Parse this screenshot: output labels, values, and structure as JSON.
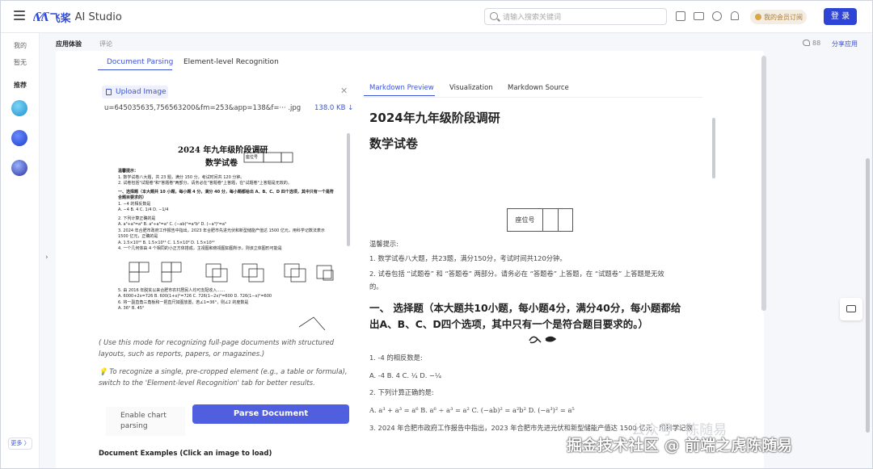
{
  "topbar": {
    "logo_mark": "ʎ⁄ʎ",
    "logo_cn": "飞桨",
    "logo_en": "AI Studio",
    "search_placeholder": "请输入搜索关键词",
    "vip_label": "我的会员订阅",
    "login_label": "登 录"
  },
  "sidebar": {
    "mine": "我的",
    "none": "暂无",
    "recommend": "推荐",
    "more": "更多 〉"
  },
  "subheader": {
    "tab_experience": "应用体验",
    "tab_comments": "评论",
    "likes": "88",
    "share": "分享应用"
  },
  "left_panel": {
    "tab_parsing": "Document Parsing",
    "tab_element": "Element-level Recognition",
    "upload_label": "Upload Image",
    "file_name": "u=645035635,756563200&fm=253&app=138&f=··· .jpg",
    "file_size": "138.0 KB ↓",
    "note_1": "( Use this mode for recognizing full-page documents with structured layouts, such as reports, papers, or magazines.)",
    "note_2": "💡 To recognize a single, pre-cropped element (e.g., a table or formula), switch to the 'Element-level Recognition' tab for better results.",
    "enable_chart": "Enable chart parsing",
    "parse_button": "Parse Document",
    "examples_heading": "Document Examples (Click an image to load)"
  },
  "thumbnail": {
    "title": "2024 年九年级阶段调研",
    "subtitle": "数学试卷",
    "seat": "座位号",
    "tips_head": "温馨提示：",
    "tip1": "1. 数学试卷八大题，共 23 题，满分 150 分，考试时间共 120 分钟。",
    "tip2": "2. 试卷包括\"试题卷\"和\"答题卷\"两部分，请务必在\"答题卷\"上答题，在\"试题卷\"上答题是无效的。",
    "sec1": "一、选择题（本大题共 10 小题，每小题 4 分，满分 40 分，每小题都给出 A、B、C、D 四个选项，其中只有一个是符合题目要求的）",
    "q1": "1. −4 的相反数是",
    "q1_opts": "A. −4      B. 4      C. 1/4      D. −1/4",
    "q2": "2. 下列计算正确的是",
    "q2_opts": "A. a³+a³=a⁶   B. a⁶÷a³=a²   C. (−ab)²=a²b²   D. (−a³)²=a⁵",
    "q3": "3. 2024 年合肥市政府工作报告中指出，2023 年合肥市先进光伏和新型储能产值达 1500 亿元，用科学记数法表示 1500 亿元，正确的是",
    "q3_opts": "A. 1.5×10¹⁰   B. 1.5×10¹¹   C. 1.5×10⁹   D. 1.5×10¹²",
    "q4": "4. 一个几何体由 4 个相同的小正方体搭成，主视图和俯视图如图所示，则该立体图形可能是",
    "q5": "5. 由 2016 年脱贫以来合肥市农村居民人均可支配收入……",
    "q5_opts": "A. 6000+2x=726   B. 600(1+x)²=726   C. 726(1−2x)²=600   D. 726(1−x)²=600",
    "q6": "6. 将一副直角三角板和一把直尺如图放置，若∠1=36°，则∠2 的度数是",
    "q6_opts": "A. 36°      B. 45°"
  },
  "right_panel": {
    "tab_preview": "Markdown Preview",
    "tab_visual": "Visualization",
    "tab_source": "Markdown Source"
  },
  "preview": {
    "h1": "2024年九年级阶段调研",
    "h1b": "数学试卷",
    "seat": "座位号",
    "tips_head": "温馨提示:",
    "tip1": "1. 数学试卷八大题，共23题，满分150分，考试时间共120分钟。",
    "tip2a": "2. 试卷包括 “试题卷” 和 “答题卷” 两部分。请务必在 “答题卷” 上答题，在 “试题卷” 上答题是无效",
    "tip2b": "的。",
    "sec1a": "一、 选择题（本大题共10小题，每小题4分，满分40分，每小题都给",
    "sec1b": "出A、B、C、D四个选项，其中只有一个是符合题目要求的。）",
    "q1": "1. -4 的相反数是:",
    "q1_opts": "A. -4 B. 4 C. ¼ D. −¼",
    "q2": "2. 下列计算正确的是:",
    "q2_opts": "A. a³ + a³ = a⁶  B. a⁶ ÷ a³ = a²  C. (−ab)² = a²b²  D. (−a³)² = a⁵",
    "q3": "3. 2024 年合肥市政府工作报告中指出，2023 年合肥市先进光伏和新型储能产值达 1500 亿元，用科学记数"
  },
  "watermark": {
    "faint": "公众号 · 陈随易",
    "main": "掘金技术社区 @ 前端之虎陈随易"
  }
}
